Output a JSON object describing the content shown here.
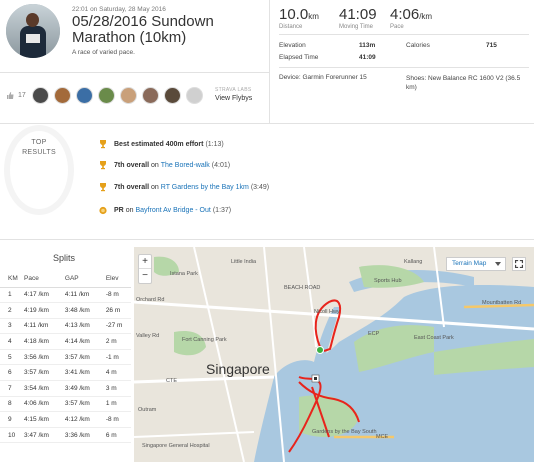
{
  "activity": {
    "timestamp": "22:01 on Saturday, 28 May 2016",
    "title": "05/28/2016 Sundown Marathon (10km)",
    "subtitle": "A race of varied pace."
  },
  "social": {
    "kudos_count": "17",
    "strava_labs": "STRAVA LABS",
    "view_flybys": "View Flybys"
  },
  "stats": {
    "distance_value": "10.0",
    "distance_unit": "km",
    "distance_label": "Distance",
    "moving_time_value": "41:09",
    "moving_time_label": "Moving Time",
    "pace_value": "4:06",
    "pace_unit": "/km",
    "pace_label": "Pace",
    "elevation_label": "Elevation",
    "elevation_value": "113m",
    "calories_label": "Calories",
    "calories_value": "715",
    "elapsed_label": "Elapsed Time",
    "elapsed_value": "41:09",
    "device": "Device: Garmin Forerunner 15",
    "shoes": "Shoes: New Balance RC 1600 V2 (36.5 km)"
  },
  "achievements": {
    "heading_line1": "TOP",
    "heading_line2": "RESULTS",
    "items": [
      {
        "bold": "Best estimated 400m effort",
        "rest": "(1:13)",
        "on": "",
        "link": ""
      },
      {
        "bold": "7th overall",
        "on": "on",
        "link": "The Bored-walk",
        "rest": "(4:01)"
      },
      {
        "bold": "7th overall",
        "on": "on",
        "link": "RT Gardens by the Bay 1km",
        "rest": "(3:49)"
      },
      {
        "bold": "PR",
        "on": "on",
        "link": "Bayfront Av Bridge - Out",
        "rest": "(1:37)"
      }
    ]
  },
  "splits": {
    "title": "Splits",
    "headers": [
      "KM",
      "Pace",
      "GAP",
      "Elev"
    ],
    "rows": [
      [
        "1",
        "4:17 /km",
        "4:11 /km",
        "-8 m"
      ],
      [
        "2",
        "4:19 /km",
        "3:48 /km",
        "26 m"
      ],
      [
        "3",
        "4:11 /km",
        "4:13 /km",
        "-27 m"
      ],
      [
        "4",
        "4:18 /km",
        "4:14 /km",
        "2 m"
      ],
      [
        "5",
        "3:56 /km",
        "3:57 /km",
        "-1 m"
      ],
      [
        "6",
        "3:57 /km",
        "3:41 /km",
        "4 m"
      ],
      [
        "7",
        "3:54 /km",
        "3:49 /km",
        "3 m"
      ],
      [
        "8",
        "4:06 /km",
        "3:57 /km",
        "1 m"
      ],
      [
        "9",
        "4:15 /km",
        "4:12 /km",
        "-8 m"
      ],
      [
        "10",
        "3:47 /km",
        "3:36 /km",
        "6 m"
      ]
    ]
  },
  "map": {
    "zoom_in": "+",
    "zoom_out": "−",
    "map_type": "Terrain Map",
    "labels": {
      "singapore": "Singapore",
      "little_india": "Little India",
      "beach_road": "BEACH ROAD",
      "sports_hub": "Sports Hub",
      "mountbatten": "Mountbatten Rd",
      "kallang": "Kallang",
      "east_coast_park": "East Coast Park",
      "fort_canning": "Fort Canning Park",
      "valley_rd": "Valley Rd",
      "orchard_rd": "Orchard Rd",
      "istana": "Istana Park",
      "outram": "Outram",
      "gardens": "Gardens by the Bay South",
      "mce": "MCE",
      "cte": "CTE",
      "ecp": "ECP",
      "general": "Singapore General Hospital",
      "nicoll": "Nicoll Hwy"
    }
  },
  "colors": {
    "route": "#e8241c",
    "water": "#a9c8e0",
    "park": "#b6d7a8",
    "road": "#ffffff",
    "link": "#1a73b8",
    "trophy": "#e5a01a"
  }
}
